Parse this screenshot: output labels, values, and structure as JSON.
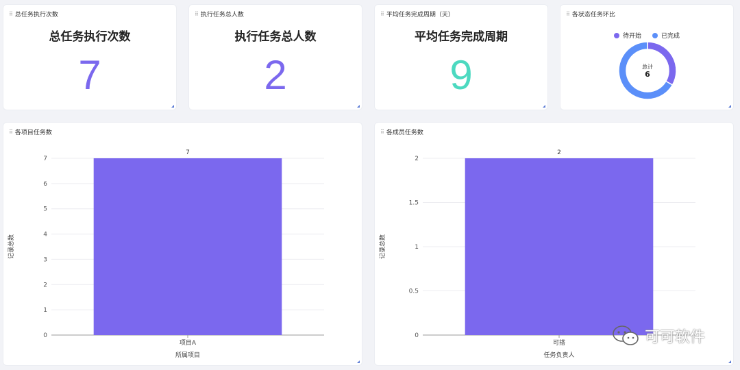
{
  "kpis": [
    {
      "card_title": "总任务执行次数",
      "heading": "总任务执行次数",
      "value": "7",
      "color": "#7b68ee"
    },
    {
      "card_title": "执行任务总人数",
      "heading": "执行任务总人数",
      "value": "2",
      "color": "#7b68ee"
    },
    {
      "card_title": "平均任务完成周期（天）",
      "heading": "平均任务完成周期",
      "value": "9",
      "color": "#4cd9c0"
    }
  ],
  "donut": {
    "card_title": "各状态任务环比",
    "center_label": "总计",
    "center_value": "6",
    "legend": [
      {
        "label": "待开始",
        "color": "#7b68ee"
      },
      {
        "label": "已完成",
        "color": "#5b8ff9"
      }
    ]
  },
  "project_chart": {
    "card_title": "各项目任务数"
  },
  "member_chart": {
    "card_title": "各成员任务数"
  },
  "chart_data": [
    {
      "type": "pie",
      "title": "各状态任务环比",
      "labels": [
        "待开始",
        "已完成"
      ],
      "values": [
        2,
        4
      ],
      "total": 6,
      "colors": [
        "#7b68ee",
        "#5b8ff9"
      ],
      "legend": "top"
    },
    {
      "type": "bar",
      "title": "各项目任务数",
      "categories": [
        "项目A"
      ],
      "values": [
        7
      ],
      "data_labels": [
        "7"
      ],
      "xlabel": "所属项目",
      "ylabel": "记录总数",
      "ylim": [
        0,
        7
      ],
      "yticks": [
        "0",
        "1",
        "2",
        "3",
        "4",
        "5",
        "6",
        "7"
      ],
      "grid": true,
      "color": "#7b68ee"
    },
    {
      "type": "bar",
      "title": "各成员任务数",
      "categories": [
        "可搭"
      ],
      "values": [
        2
      ],
      "data_labels": [
        "2"
      ],
      "xlabel": "任务负责人",
      "ylabel": "记录总数",
      "ylim": [
        0,
        2
      ],
      "yticks": [
        "0",
        "0.5",
        "1",
        "1.5",
        "2"
      ],
      "grid": true,
      "color": "#7b68ee"
    }
  ],
  "watermark": {
    "text": "可可软件",
    "icon": "wechat-icon"
  }
}
